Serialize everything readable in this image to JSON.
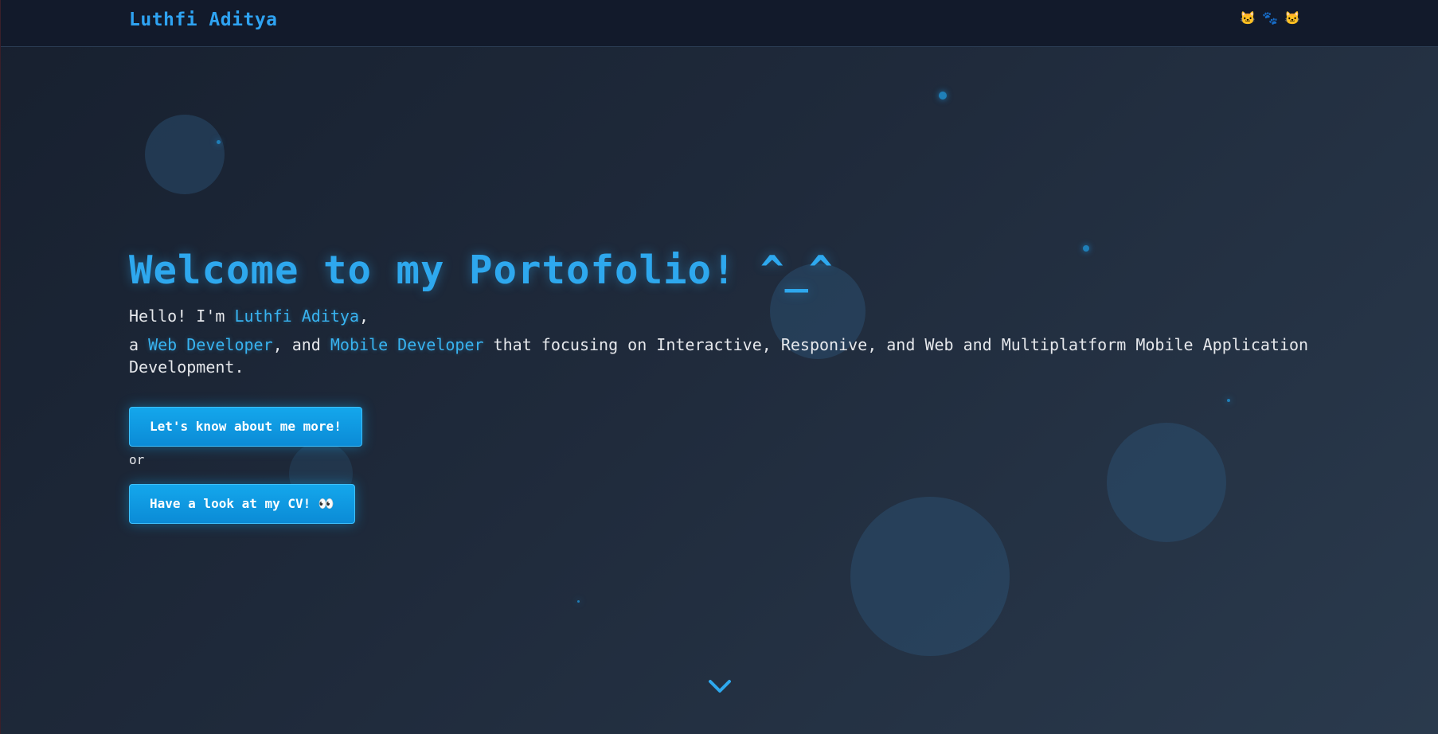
{
  "navbar": {
    "brand": "Luthfi Aditya",
    "icons": [
      "cat-face-icon",
      "paw-icon",
      "cat-face-icon"
    ]
  },
  "hero": {
    "title": "Welcome to my Portofolio! ^_^",
    "greeting_prefix": "Hello! I'm ",
    "name": "Luthfi Aditya",
    "greeting_suffix": ",",
    "desc_prefix": "a ",
    "role1": "Web Developer",
    "desc_mid": ", and ",
    "role2": "Mobile Developer",
    "desc_suffix": " that focusing on Interactive, Responive, and Web and Multiplatform Mobile Application Development."
  },
  "actions": {
    "about_button": "Let's know about me more!",
    "or_text": "or",
    "cv_button": "Have a look at my CV! 👀"
  },
  "colors": {
    "accent": "#2ea3f2",
    "button": "#14a7ec",
    "background": "#1f2a3b"
  }
}
